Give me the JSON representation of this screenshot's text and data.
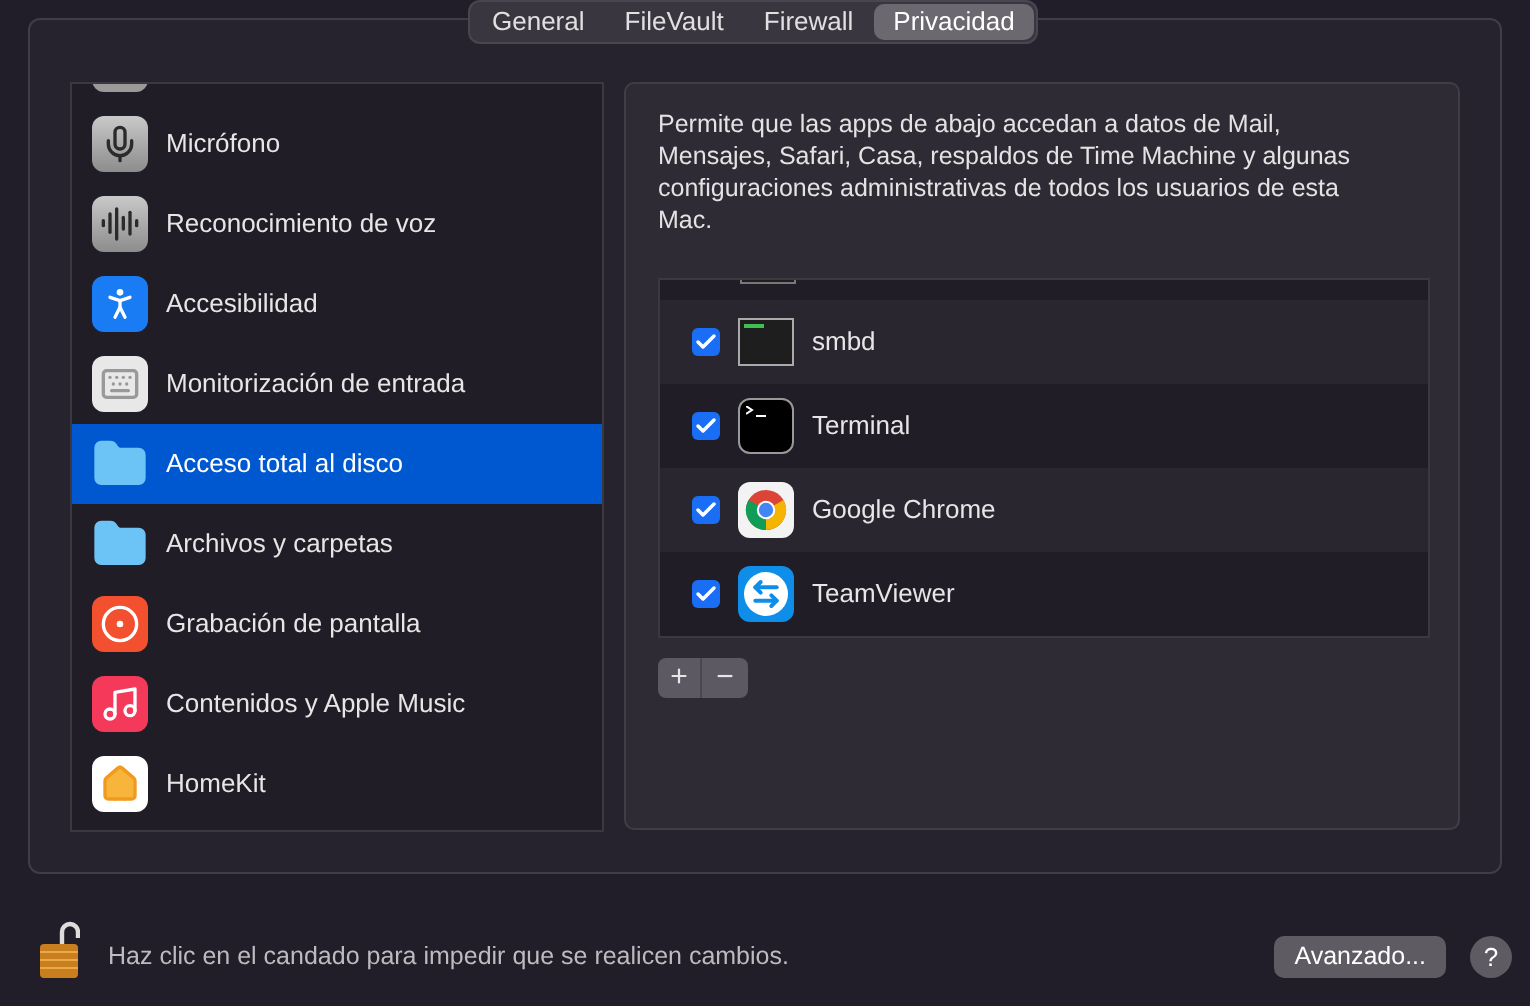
{
  "tabs": [
    {
      "label": "General",
      "selected": false
    },
    {
      "label": "FileVault",
      "selected": false
    },
    {
      "label": "Firewall",
      "selected": false
    },
    {
      "label": "Privacidad",
      "selected": true
    }
  ],
  "sidebar": {
    "items": [
      {
        "label": "Micrófono",
        "selected": false
      },
      {
        "label": "Reconocimiento de voz",
        "selected": false
      },
      {
        "label": "Accesibilidad",
        "selected": false
      },
      {
        "label": "Monitorización de entrada",
        "selected": false
      },
      {
        "label": "Acceso total al disco",
        "selected": true
      },
      {
        "label": "Archivos y carpetas",
        "selected": false
      },
      {
        "label": "Grabación de pantalla",
        "selected": false
      },
      {
        "label": "Contenidos y Apple Music",
        "selected": false
      },
      {
        "label": "HomeKit",
        "selected": false
      }
    ]
  },
  "description": "Permite que las apps de abajo accedan a datos de Mail, Mensajes, Safari, Casa, respaldos de Time Machine y algunas configuraciones administrativas de todos los usuarios de esta Mac.",
  "apps": [
    {
      "name": "smbd",
      "checked": true
    },
    {
      "name": "Terminal",
      "checked": true
    },
    {
      "name": "Google Chrome",
      "checked": true
    },
    {
      "name": "TeamViewer",
      "checked": true
    }
  ],
  "add_remove": {
    "add": "+",
    "remove": "−"
  },
  "footer": {
    "lock_text": "Haz clic en el candado para impedir que se realicen cambios.",
    "advanced_button": "Avanzado...",
    "help": "?"
  }
}
